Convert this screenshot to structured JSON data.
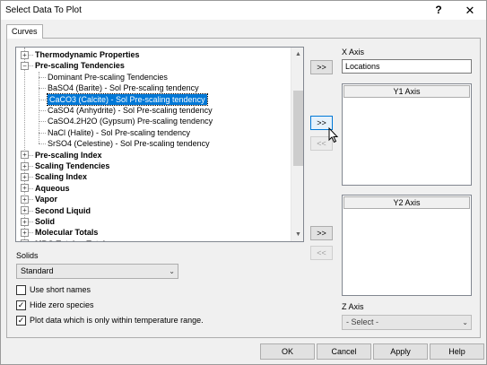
{
  "window": {
    "title": "Select Data To Plot",
    "help": "?",
    "close": "✕"
  },
  "tabs": [
    {
      "label": "Curves"
    }
  ],
  "tree": {
    "items": [
      {
        "label": "Thermodynamic Properties",
        "bold": true,
        "expanded": false,
        "level": 0
      },
      {
        "label": "Pre-scaling Tendencies",
        "bold": true,
        "expanded": true,
        "level": 0
      },
      {
        "label": "Dominant Pre-scaling Tendencies",
        "level": 1
      },
      {
        "label": "BaSO4 (Barite) - Sol Pre-scaling tendency",
        "level": 1
      },
      {
        "label": "CaCO3 (Calcite) - Sol Pre-scaling tendency",
        "level": 1,
        "selected": true
      },
      {
        "label": "CaSO4 (Anhydrite) - Sol Pre-scaling tendency",
        "level": 1
      },
      {
        "label": "CaSO4.2H2O (Gypsum) Pre-scaling tendency",
        "level": 1
      },
      {
        "label": "NaCl (Halite) - Sol Pre-scaling tendency",
        "level": 1
      },
      {
        "label": "SrSO4 (Celestine) - Sol Pre-scaling tendency",
        "level": 1
      },
      {
        "label": "Pre-scaling Index",
        "bold": true,
        "expanded": false,
        "level": 0
      },
      {
        "label": "Scaling Tendencies",
        "bold": true,
        "expanded": false,
        "level": 0
      },
      {
        "label": "Scaling Index",
        "bold": true,
        "expanded": false,
        "level": 0
      },
      {
        "label": "Aqueous",
        "bold": true,
        "expanded": false,
        "level": 0
      },
      {
        "label": "Vapor",
        "bold": true,
        "expanded": false,
        "level": 0
      },
      {
        "label": "Second Liquid",
        "bold": true,
        "expanded": false,
        "level": 0
      },
      {
        "label": "Solid",
        "bold": true,
        "expanded": false,
        "level": 0
      },
      {
        "label": "Molecular Totals",
        "bold": true,
        "expanded": false,
        "level": 0
      },
      {
        "label": "MBG Totals - Total",
        "bold": true,
        "expanded": false,
        "level": 0
      }
    ],
    "plus": "+",
    "minus": "−",
    "scroll_up": "▲",
    "scroll_down": "▼"
  },
  "transfer": {
    "x_add": ">>",
    "y1_add": ">>",
    "y1_remove": "<<",
    "y2_add": ">>",
    "y2_remove": "<<"
  },
  "x_axis": {
    "label": "X Axis",
    "value": "Locations"
  },
  "y1_axis": {
    "header": "Y1 Axis"
  },
  "y2_axis": {
    "header": "Y2 Axis"
  },
  "z_axis": {
    "label": "Z  Axis",
    "value": "- Select -"
  },
  "solids": {
    "label": "Solids",
    "value": "Standard"
  },
  "options": [
    {
      "label": "Use short names",
      "checked": false
    },
    {
      "label": "Hide zero species",
      "checked": true
    },
    {
      "label": "Plot data which is only within temperature range.",
      "checked": true
    }
  ],
  "checkmark": "✓",
  "chevron": "⌄",
  "buttons": {
    "ok": "OK",
    "cancel": "Cancel",
    "apply": "Apply",
    "help": "Help"
  }
}
